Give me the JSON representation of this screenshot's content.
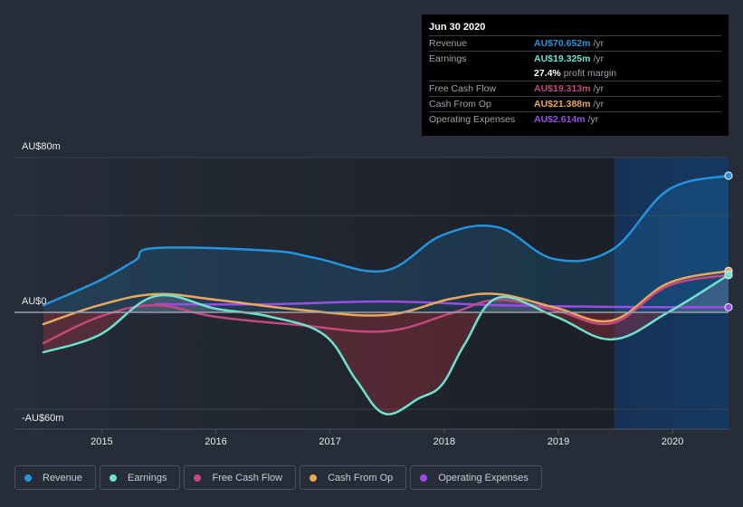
{
  "tooltip": {
    "date": "Jun 30 2020",
    "rows": [
      {
        "label": "Revenue",
        "value": "AU$70.652m",
        "unit": "/yr",
        "color": "#2394df"
      },
      {
        "label": "Earnings",
        "value": "AU$19.325m",
        "unit": "/yr",
        "color": "#6ce2cf"
      },
      {
        "label": "",
        "value": "27.4%",
        "unit": "profit margin",
        "color": "#ffffff"
      },
      {
        "label": "Free Cash Flow",
        "value": "AU$19.313m",
        "unit": "/yr",
        "color": "#c4487f"
      },
      {
        "label": "Cash From Op",
        "value": "AU$21.388m",
        "unit": "/yr",
        "color": "#e8a95a"
      },
      {
        "label": "Operating Expenses",
        "value": "AU$2.614m",
        "unit": "/yr",
        "color": "#9b4ce8"
      }
    ]
  },
  "legend": [
    {
      "label": "Revenue",
      "color": "#2394df"
    },
    {
      "label": "Earnings",
      "color": "#6ce2cf"
    },
    {
      "label": "Free Cash Flow",
      "color": "#c4487f"
    },
    {
      "label": "Cash From Op",
      "color": "#e8a95a"
    },
    {
      "label": "Operating Expenses",
      "color": "#9b4ce8"
    }
  ],
  "chart_data": {
    "type": "line",
    "title": "",
    "xlabel": "",
    "ylabel": "",
    "y_tick_labels": [
      "AU$80m",
      "AU$0",
      "-AU$60m"
    ],
    "x_tick_labels": [
      "2015",
      "2016",
      "2017",
      "2018",
      "2019",
      "2020"
    ],
    "xlim": [
      2014.49,
      2020.49
    ],
    "ylim": [
      -60,
      80
    ],
    "highlight_start": 2019.49,
    "units": "AU$ millions",
    "series": [
      {
        "name": "Revenue",
        "color": "#2394df",
        "x": [
          2014.49,
          2014.98,
          2015.29,
          2015.47,
          2016.48,
          2016.87,
          2017.48,
          2017.98,
          2018.47,
          2018.96,
          2019.47,
          2019.96,
          2020.49
        ],
        "values": [
          3.7,
          16.4,
          26.7,
          33.2,
          31.8,
          28.1,
          21.5,
          39.8,
          44.0,
          27.6,
          32.3,
          63.2,
          70.652
        ]
      },
      {
        "name": "Earnings",
        "color": "#6ce2cf",
        "x": [
          2014.49,
          2014.98,
          2015.47,
          2016.0,
          2016.48,
          2016.95,
          2017.23,
          2017.48,
          2017.78,
          2017.98,
          2018.18,
          2018.47,
          2018.98,
          2019.47,
          2019.96,
          2020.49
        ],
        "values": [
          -20.6,
          -11.7,
          8.4,
          1.9,
          -2.3,
          -11.7,
          -35.1,
          -52.4,
          -44.4,
          -37.4,
          -16.4,
          7.5,
          -2.3,
          -14.0,
          0.0,
          19.325
        ]
      },
      {
        "name": "Free Cash Flow",
        "color": "#c4487f",
        "x": [
          2014.49,
          2014.98,
          2015.47,
          2016.0,
          2016.72,
          2017.48,
          2018.06,
          2018.47,
          2018.98,
          2019.47,
          2019.96,
          2020.49
        ],
        "values": [
          -15.9,
          -2.3,
          3.7,
          -2.3,
          -6.5,
          -9.8,
          -0.5,
          6.5,
          0.9,
          -5.6,
          13.6,
          19.313
        ]
      },
      {
        "name": "Cash From Op",
        "color": "#e8a95a",
        "x": [
          2014.49,
          2014.98,
          2015.47,
          2016.0,
          2016.72,
          2017.48,
          2018.06,
          2018.47,
          2018.98,
          2019.47,
          2019.96,
          2020.49
        ],
        "values": [
          -6.1,
          3.7,
          9.4,
          6.5,
          1.4,
          -1.4,
          7.0,
          9.4,
          2.3,
          -4.2,
          15.0,
          21.388
        ]
      },
      {
        "name": "Operating Expenses",
        "color": "#9b4ce8",
        "x": [
          2015.47,
          2016.48,
          2017.48,
          2018.47,
          2019.47,
          2020.49
        ],
        "values": [
          4.2,
          4.2,
          5.6,
          3.7,
          2.8,
          2.614
        ]
      }
    ]
  }
}
